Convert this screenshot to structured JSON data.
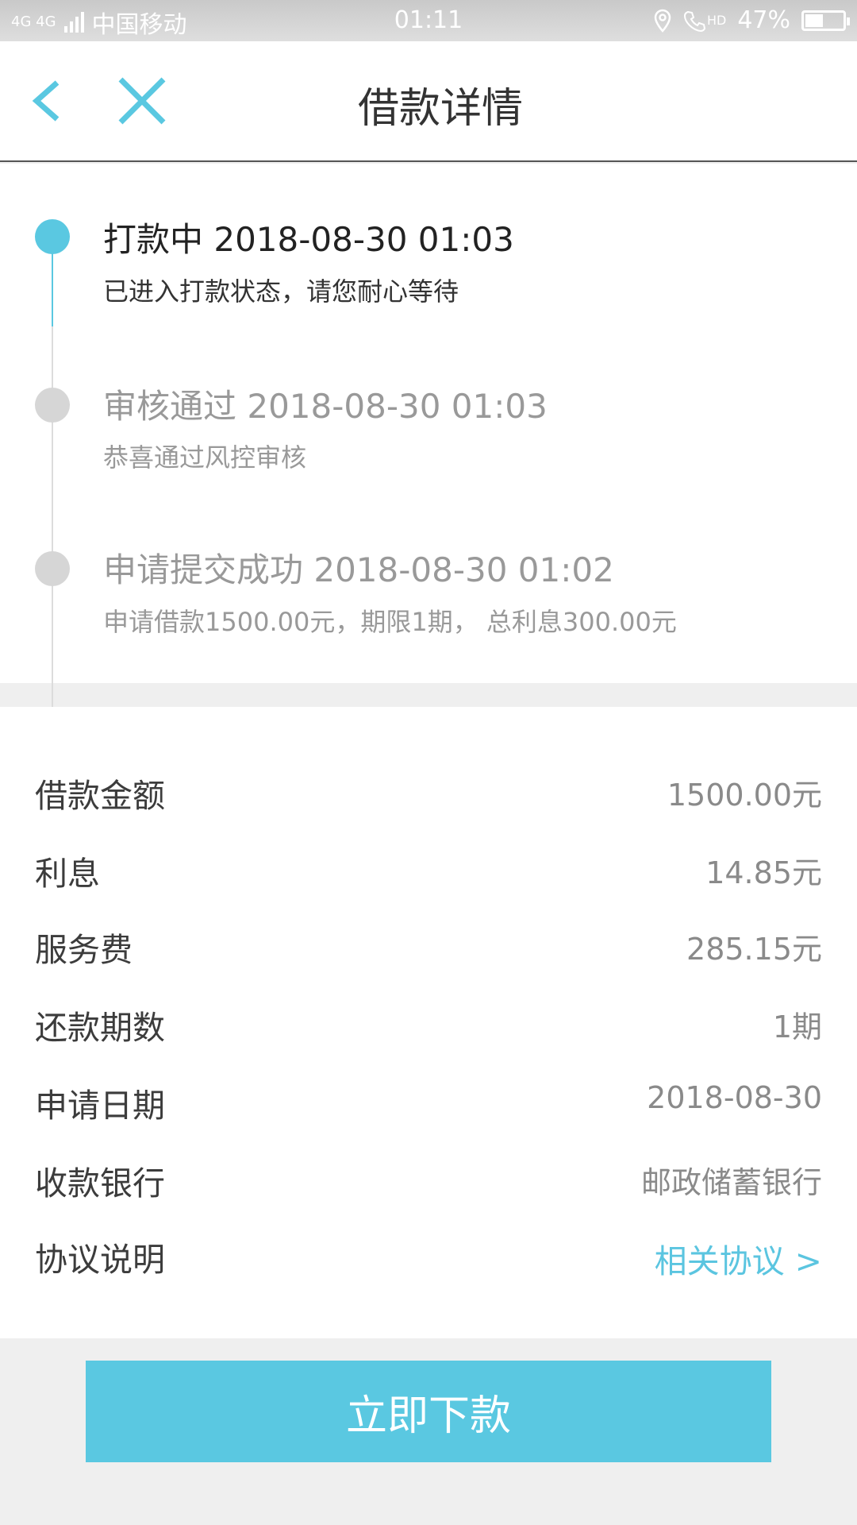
{
  "status_bar": {
    "network": "4G 4G",
    "carrier": "中国移动",
    "time": "01:11",
    "hd": "HD",
    "battery": "47%"
  },
  "header": {
    "title": "借款详情",
    "back_icon": "chevron-left-icon",
    "close_icon": "close-icon"
  },
  "timeline": [
    {
      "title": "打款中 2018-08-30 01:03",
      "desc": "已进入打款状态，请您耐心等待",
      "active": true
    },
    {
      "title": "审核通过 2018-08-30 01:03",
      "desc": "恭喜通过风控审核",
      "active": false
    },
    {
      "title": "申请提交成功 2018-08-30 01:02",
      "desc": "申请借款1500.00元，期限1期， 总利息300.00元",
      "active": false
    }
  ],
  "details": [
    {
      "label": "借款金额",
      "value": "1500.00元"
    },
    {
      "label": "利息",
      "value": "14.85元"
    },
    {
      "label": "服务费",
      "value": "285.15元"
    },
    {
      "label": "还款期数",
      "value": "1期"
    },
    {
      "label": "申请日期",
      "value": "2018-08-30"
    },
    {
      "label": "收款银行",
      "value": "邮政储蓄银行"
    },
    {
      "label": "协议说明",
      "value": "相关协议 >"
    }
  ],
  "action": {
    "label": "立即下款"
  },
  "colors": {
    "accent": "#5ac8e1",
    "active_text": "#222222",
    "inactive_text": "#999999"
  }
}
